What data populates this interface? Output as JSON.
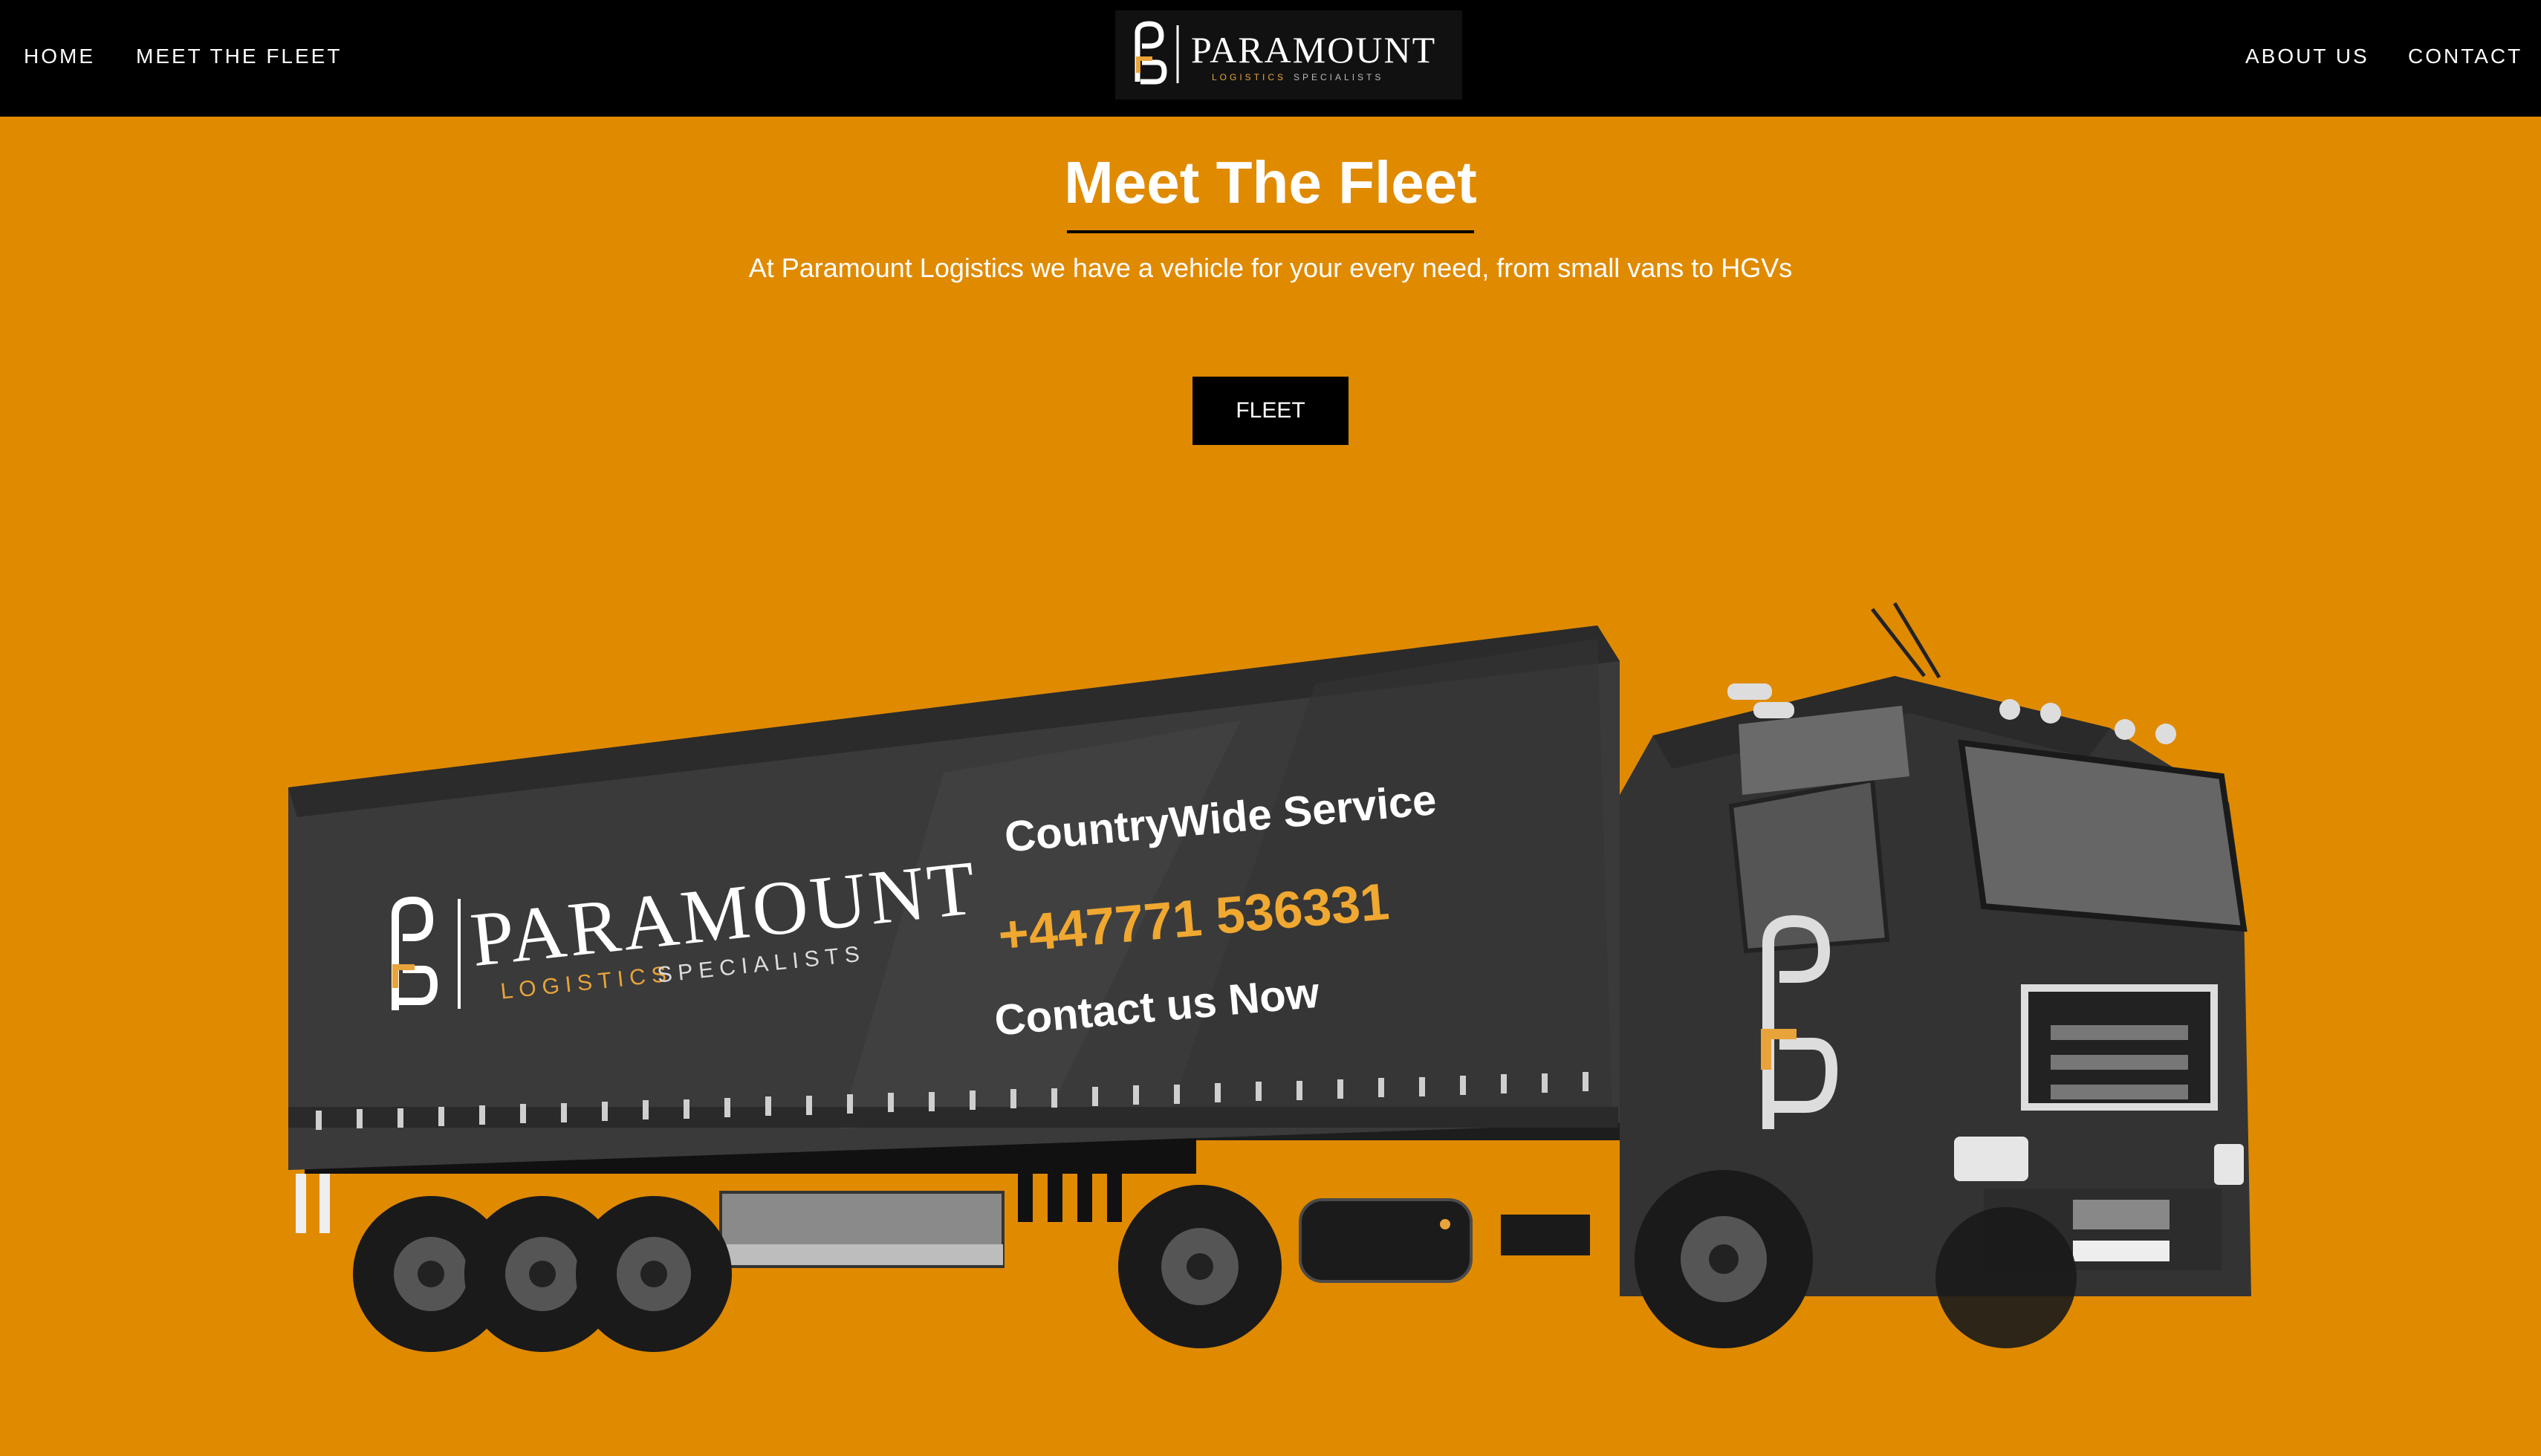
{
  "nav": {
    "left": [
      {
        "label": "HOME"
      },
      {
        "label": "MEET THE FLEET"
      }
    ],
    "right": [
      {
        "label": "ABOUT US"
      },
      {
        "label": "CONTACT"
      }
    ],
    "logo": {
      "name": "PARAMOUNT",
      "tagline_word1": "LOGISTICS",
      "tagline_word2": "SPECIALISTS"
    }
  },
  "hero": {
    "title": "Meet The Fleet",
    "subtitle": "At Paramount Logistics we have a vehicle for your every need, from small vans to HGVs",
    "button_label": "FLEET"
  },
  "truck": {
    "brand": "PARAMOUNT",
    "tagline_word1": "LOGISTICS",
    "tagline_word2": "SPECIALISTS",
    "service": "CountryWide Service",
    "phone": "+447771 536331",
    "contact": "Contact us Now"
  },
  "colors": {
    "background": "#e08a00",
    "nav": "#000000",
    "accent": "#e8a33a",
    "truck_body": "#3a3a3a"
  }
}
